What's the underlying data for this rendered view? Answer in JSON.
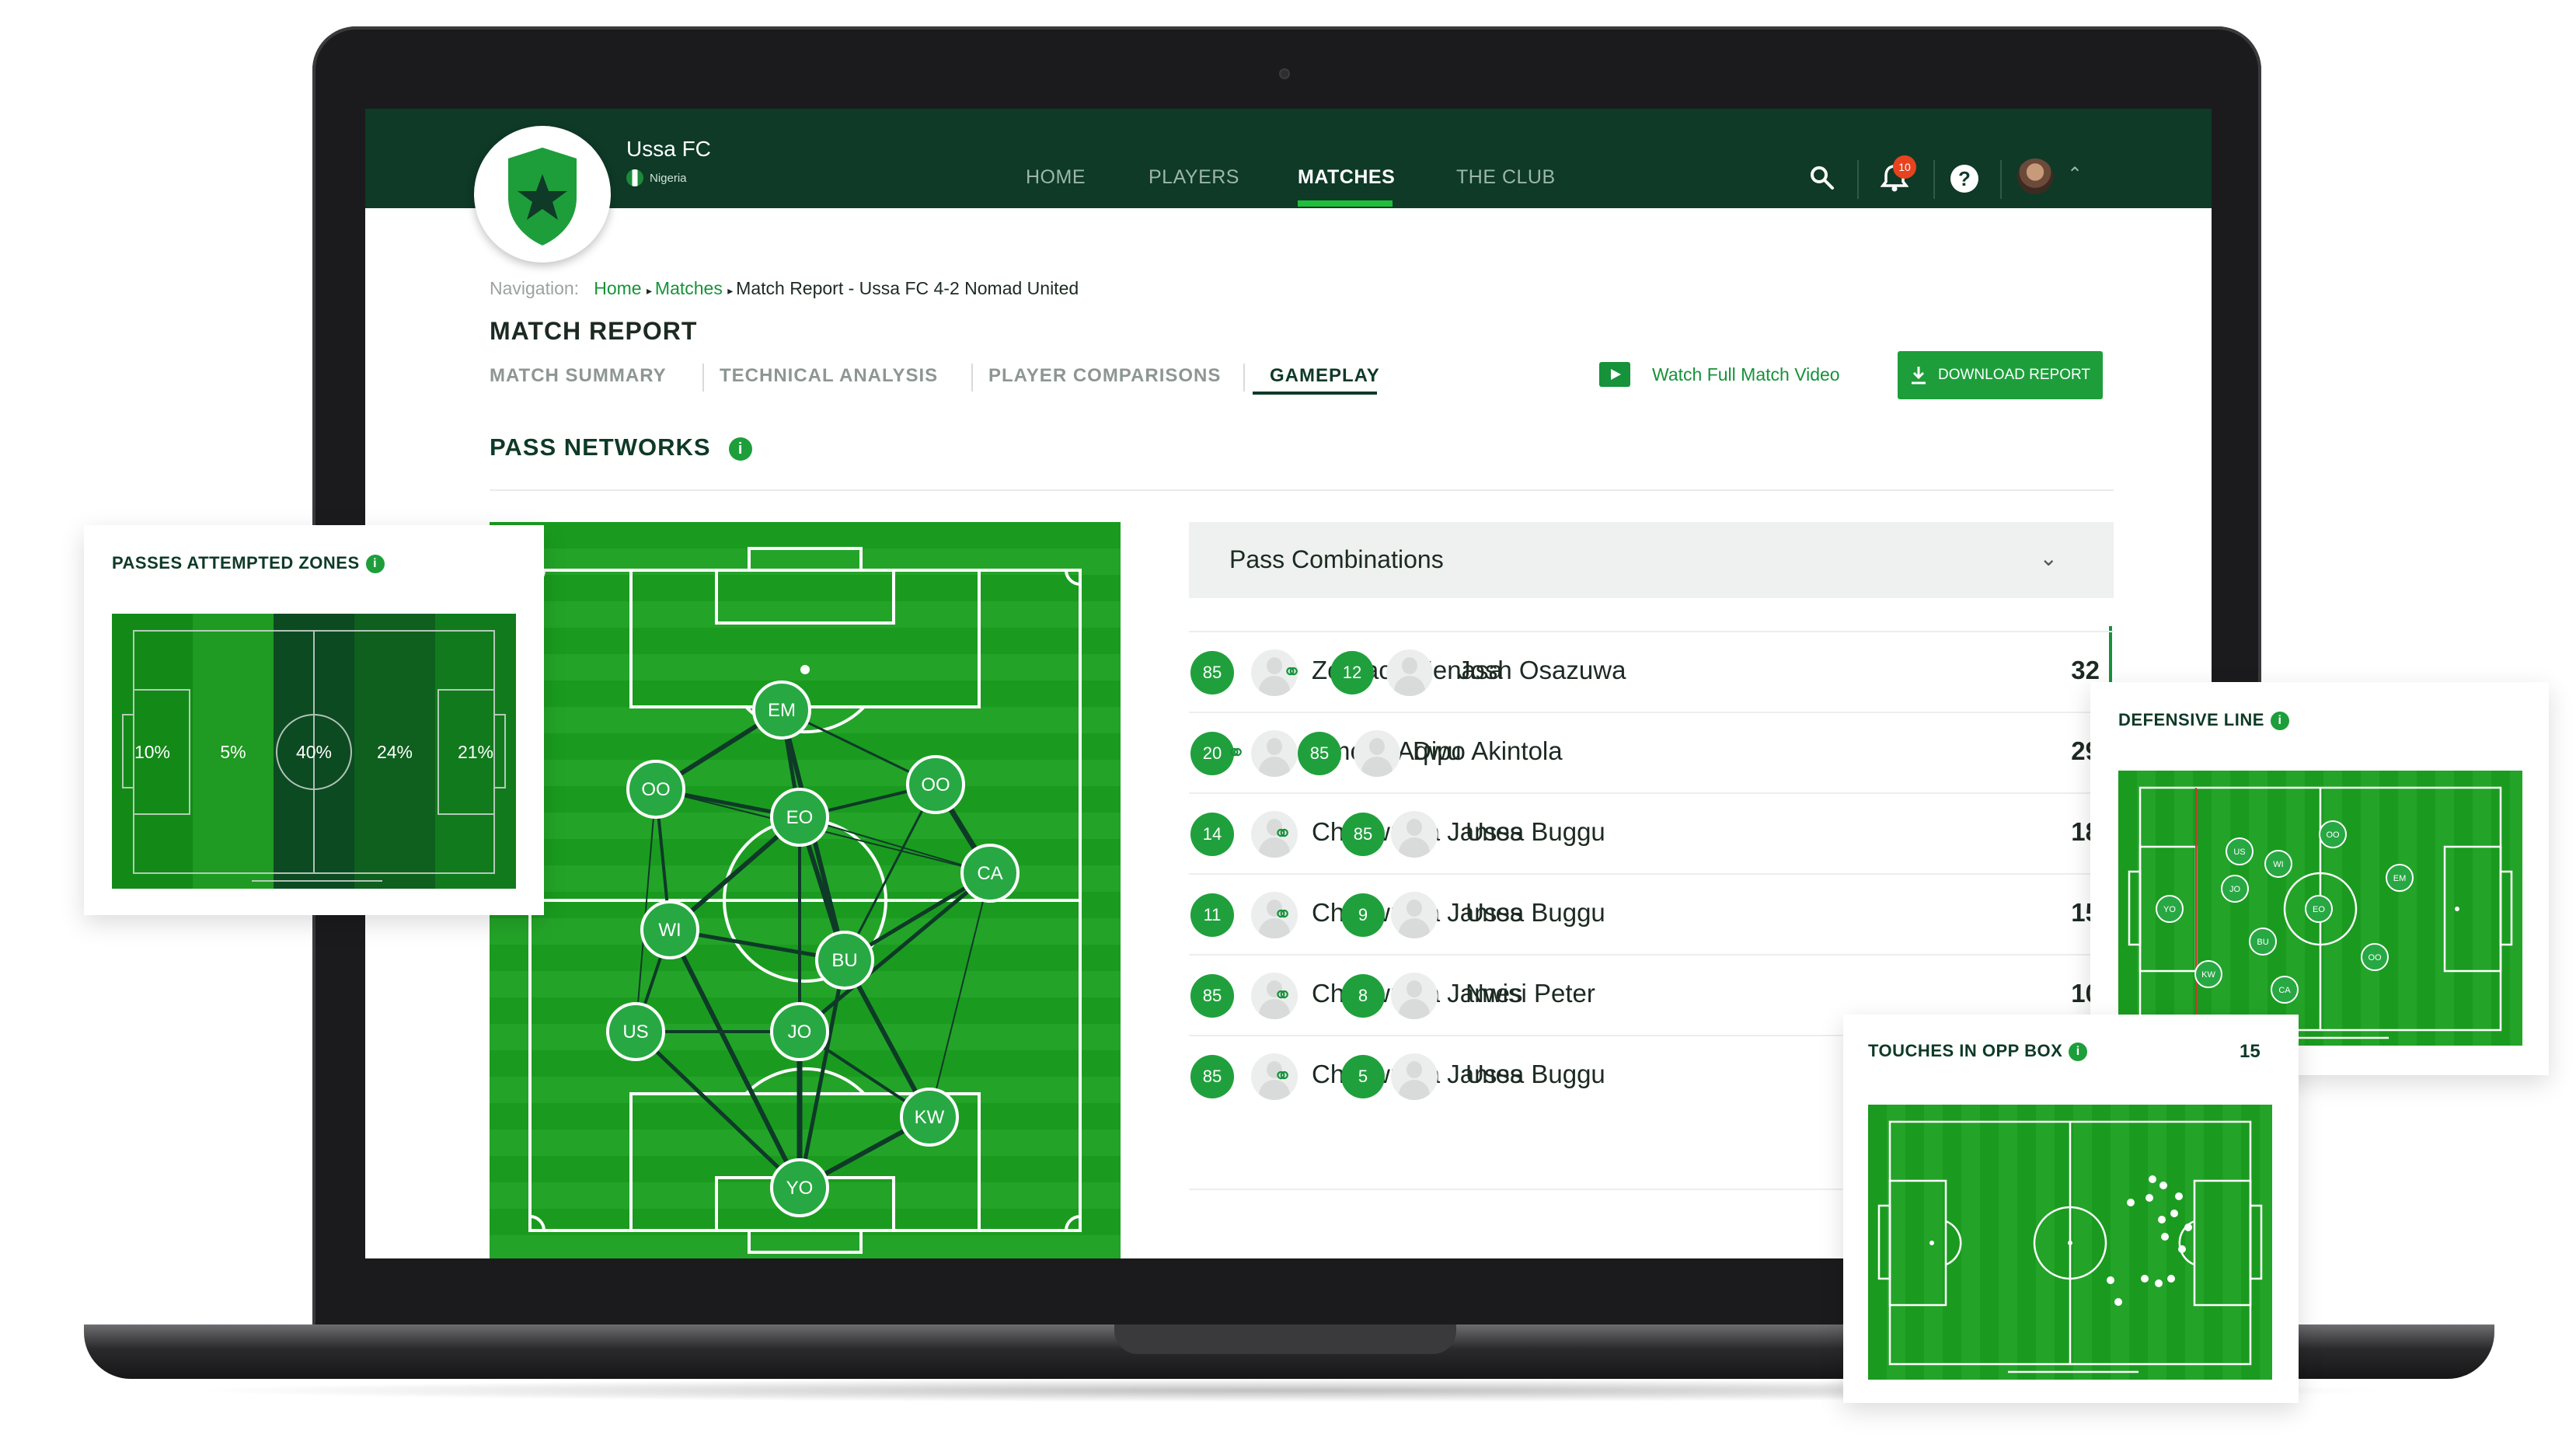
{
  "club": {
    "name": "Ussa FC",
    "country": "Nigeria"
  },
  "nav": {
    "items": [
      {
        "label": "HOME",
        "active": false
      },
      {
        "label": "PLAYERS",
        "active": false
      },
      {
        "label": "MATCHES",
        "active": true
      },
      {
        "label": "THE CLUB",
        "active": false
      }
    ],
    "notification_count": "10"
  },
  "breadcrumb": {
    "prefix": "Navigation:",
    "items": [
      "Home",
      "Matches"
    ],
    "current": "Match Report - Ussa FC 4-2 Nomad United"
  },
  "page_title": "MATCH REPORT",
  "tabs": [
    {
      "label": "MATCH SUMMARY",
      "active": false
    },
    {
      "label": "TECHNICAL ANALYSIS",
      "active": false
    },
    {
      "label": "PLAYER COMPARISONS",
      "active": false
    },
    {
      "label": "GAMEPLAY",
      "active": true
    }
  ],
  "actions": {
    "video_label": "Watch Full Match Video",
    "download_label": "DOWNLOAD REPORT"
  },
  "section_title": "PASS NETWORKS",
  "pass_network": {
    "players": [
      "EM",
      "OO",
      "OO",
      "EO",
      "CA",
      "WI",
      "BU",
      "US",
      "JO",
      "KW",
      "YO"
    ]
  },
  "combinations": {
    "title": "Pass Combinations",
    "rows": [
      {
        "num1": "85",
        "name1": "Zedrack Menasa",
        "num2": "12",
        "name2": "Josh Osazuwa",
        "count": "32"
      },
      {
        "num1": "20",
        "name1": "Emeka Aqwu",
        "num2": "85",
        "name2": "Dipo Akintola",
        "count": "29"
      },
      {
        "num1": "14",
        "name1": "Chukwuma James",
        "num2": "85",
        "name2": "Ussa Buggu",
        "count": "18"
      },
      {
        "num1": "11",
        "name1": "Chukwuma James",
        "num2": "9",
        "name2": "Ussa Buggu",
        "count": "15"
      },
      {
        "num1": "85",
        "name1": "Chukwuma James",
        "num2": "8",
        "name2": "Nwisi Peter",
        "count": "10"
      },
      {
        "num1": "85",
        "name1": "Chukwuma James",
        "num2": "5",
        "name2": "Ussa Buggu",
        "count": ""
      }
    ]
  },
  "cards": {
    "passes_zones": {
      "title": "PASSES ATTEMPTED ZONES",
      "zones": [
        "10%",
        "5%",
        "40%",
        "24%",
        "21%"
      ]
    },
    "defensive_line": {
      "title": "DEFENSIVE LINE",
      "players": [
        "US",
        "WI",
        "OO",
        "JO",
        "EM",
        "YO",
        "EO",
        "BU",
        "OO",
        "KW",
        "CA"
      ]
    },
    "touches": {
      "title": "TOUCHES IN OPP BOX",
      "value": "15"
    }
  },
  "colors": {
    "brand_dark": "#0e3a27",
    "accent": "#1d9e3b",
    "pitch": "#1a9b1f"
  }
}
